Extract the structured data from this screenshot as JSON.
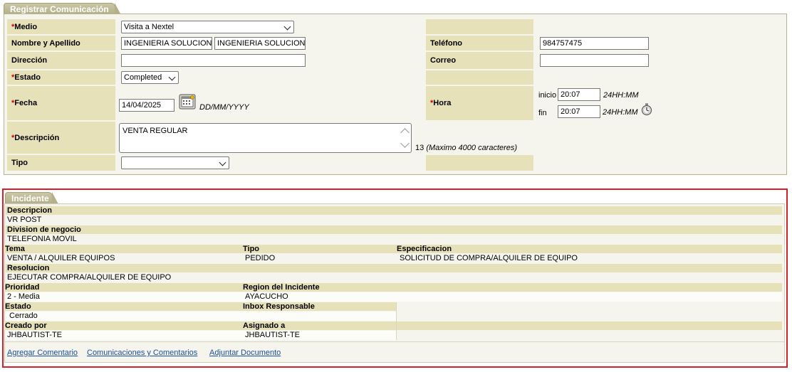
{
  "registrar": {
    "title": "Registrar Comunicación",
    "medio_label": "Medio",
    "medio_value": "Visita a Nextel",
    "nombre_label": "Nombre y Apellido",
    "nombre_value": "INGENIERIA SOLUCIONES",
    "apellido_value": "INGENIERIA SOLUCIONES",
    "telefono_label": "Teléfono",
    "telefono_value": "984757475",
    "direccion_label": "Dirección",
    "direccion_value": "",
    "correo_label": "Correo",
    "correo_value": "",
    "estado_label": "Estado",
    "estado_value": "Completed",
    "fecha_label": "Fecha",
    "fecha_value": "14/04/2025",
    "fecha_format": "DD/MM/YYYY",
    "hora_label": "Hora",
    "inicio_label": "inicio",
    "inicio_value": "20:07",
    "fin_label": "fin",
    "fin_value": "20:07",
    "hora_format": "24HH:MM",
    "descripcion_label": "Descripción",
    "descripcion_value": "VENTA REGULAR",
    "descripcion_count": "13",
    "descripcion_limit": "(Maximo 4000 caracteres)",
    "tipo_label": "Tipo",
    "tipo_value": "",
    "required_mark": "*"
  },
  "incidente": {
    "title": "Incidente",
    "descripcion_label": "Descripcion",
    "descripcion_value": "VR POST",
    "division_label": "Division de negocio",
    "division_value": "TELEFONIA MOVIL",
    "tema_label": "Tema",
    "tema_value": "VENTA / ALQUILER EQUIPOS",
    "tipo_label": "Tipo",
    "tipo_value": "PEDIDO",
    "especificacion_label": "Especificacion",
    "especificacion_value": "SOLICITUD DE COMPRA/ALQUILER DE EQUIPO",
    "resolucion_label": "Resolucion",
    "resolucion_value": "EJECUTAR COMPRA/ALQUILER DE EQUIPO",
    "prioridad_label": "Prioridad",
    "prioridad_value": "2 - Media",
    "region_label": "Region del Incidente",
    "region_value": "AYACUCHO",
    "estado_label": "Estado",
    "estado_value": "Cerrado",
    "inbox_label": "Inbox Responsable",
    "inbox_value": "",
    "creado_label": "Creado por",
    "creado_value": "JHBAUTIST-TE",
    "asignado_label": "Asignado a",
    "asignado_value": "JHBAUTIST-TE"
  },
  "links": {
    "agregar": "Agregar Comentario",
    "comunicaciones": "Comunicaciones y Comentarios",
    "adjuntar": "Adjuntar Documento"
  },
  "icons": {
    "calendar": "calendar-icon",
    "clock": "clock-icon"
  }
}
